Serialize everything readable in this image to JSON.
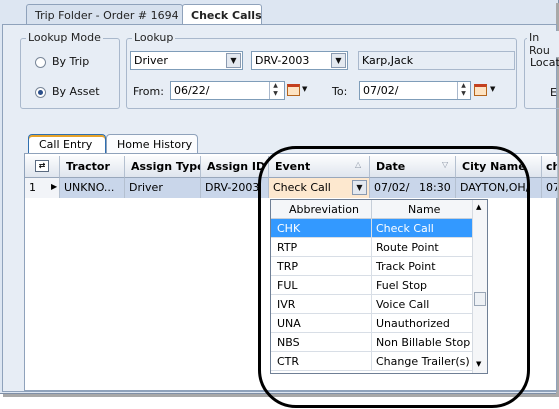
{
  "tabs": {
    "trip_folder": "Trip Folder - Order # 1694",
    "check_calls": "Check Calls"
  },
  "lookup_mode": {
    "title": "Lookup Mode",
    "by_trip": "By Trip",
    "by_asset": "By Asset",
    "selected": "By Asset"
  },
  "lookup": {
    "title": "Lookup",
    "type_value": "Driver",
    "id_value": "DRV-2003",
    "name_value": "Karp,Jack",
    "from_label": "From:",
    "from_value": "06/22/",
    "to_label": "To:",
    "to_value": "07/02/"
  },
  "in_route": {
    "title": "In Rou",
    "location_label": "Locati",
    "e_label": "E"
  },
  "entry_tabs": {
    "call_entry": "Call Entry",
    "home_history": "Home History"
  },
  "grid": {
    "columns": [
      "Tractor",
      "Assign Type",
      "Assign ID",
      "Event",
      "Date",
      "City Name",
      "ch"
    ],
    "row": {
      "num": "1",
      "tractor": "UNKNO...",
      "assign_type": "Driver",
      "assign_id": "DRV-2003",
      "event": "Check Call",
      "date": "07/02/",
      "time": "18:30",
      "city": "DAYTON,OH/",
      "extra": "07/"
    }
  },
  "event_dropdown": {
    "headers": [
      "Abbreviation",
      "Name"
    ],
    "options": [
      {
        "abbr": "CHK",
        "name": "Check Call"
      },
      {
        "abbr": "RTP",
        "name": "Route Point"
      },
      {
        "abbr": "TRP",
        "name": "Track Point"
      },
      {
        "abbr": "FUL",
        "name": "Fuel Stop"
      },
      {
        "abbr": "IVR",
        "name": "Voice Call"
      },
      {
        "abbr": "UNA",
        "name": "Unauthorized"
      },
      {
        "abbr": "NBS",
        "name": "Non Billable Stop"
      },
      {
        "abbr": "CTR",
        "name": "Change Trailer(s)"
      }
    ],
    "selected_index": 0
  },
  "colors": {
    "selection": "#3399ff",
    "row_highlight": "#c9d6ea",
    "panel_bg": "#e7edf5",
    "annotation_circle": "#000000"
  }
}
